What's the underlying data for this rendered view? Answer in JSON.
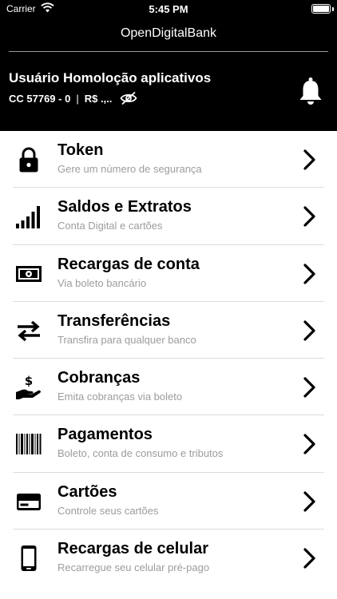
{
  "status_bar": {
    "carrier": "Carrier",
    "time": "5:45 PM"
  },
  "app": {
    "title": "OpenDigitalBank"
  },
  "account": {
    "user_name": "Usuário Homoloção aplicativos",
    "account_number": "CC 57769 - 0",
    "separator": "|",
    "balance": "R$ .,.."
  },
  "menu": {
    "items": [
      {
        "icon": "lock-icon",
        "title": "Token",
        "subtitle": "Gere um número de segurança"
      },
      {
        "icon": "signal-bars-icon",
        "title": "Saldos e Extratos",
        "subtitle": "Conta Digital e cartões"
      },
      {
        "icon": "banknote-icon",
        "title": "Recargas de conta",
        "subtitle": "Via boleto bancário"
      },
      {
        "icon": "transfer-arrows-icon",
        "title": "Transferências",
        "subtitle": "Transfira para qualquer banco"
      },
      {
        "icon": "hand-money-icon",
        "title": "Cobranças",
        "subtitle": "Emita cobranças via boleto"
      },
      {
        "icon": "barcode-icon",
        "title": "Pagamentos",
        "subtitle": "Boleto, conta de consumo e tributos"
      },
      {
        "icon": "credit-card-icon",
        "title": "Cartões",
        "subtitle": "Controle seus cartões"
      },
      {
        "icon": "smartphone-icon",
        "title": "Recargas de celular",
        "subtitle": "Recarregue seu celular pré-pago"
      }
    ]
  },
  "colors": {
    "header_bg": "#000000",
    "header_text": "#ffffff",
    "subtitle_text": "#9c9c9c",
    "divider": "#dcdcdc"
  }
}
